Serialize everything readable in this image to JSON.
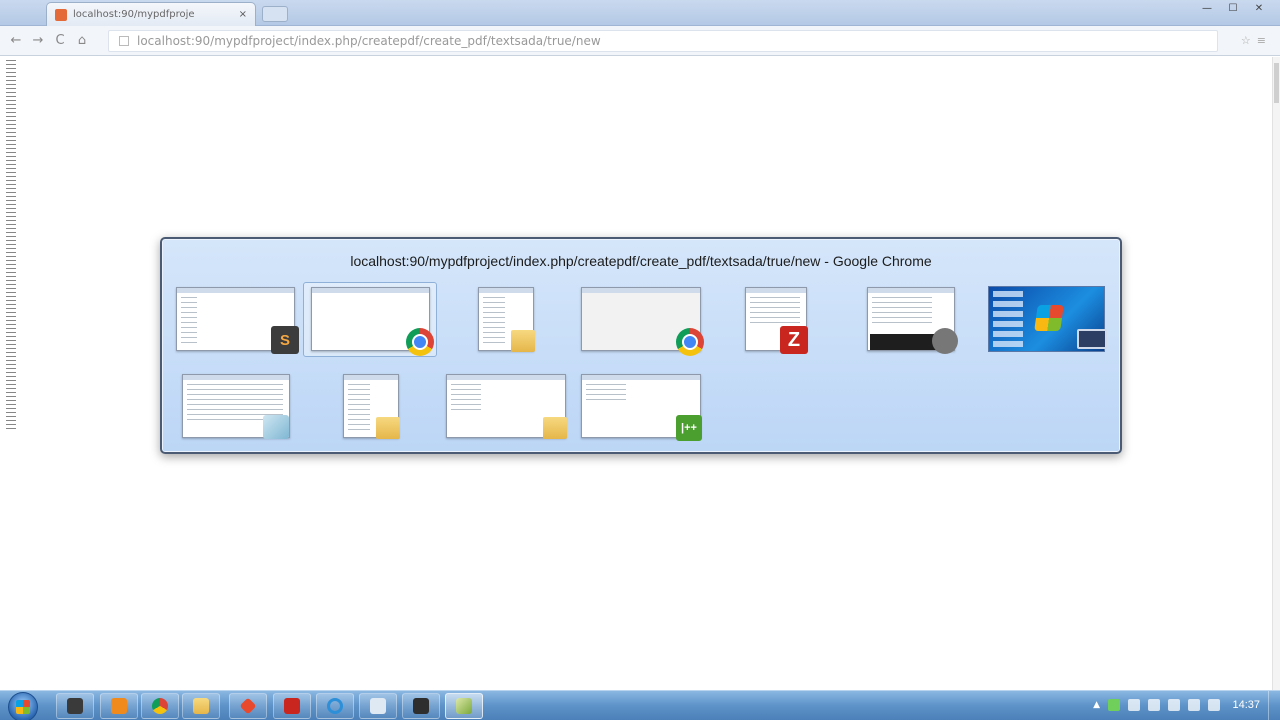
{
  "browser": {
    "tab_title": "localhost:90/mypdfproje",
    "tab_close": "×",
    "address": "localhost:90/mypdfproject/index.php/createpdf/create_pdf/textsada/true/new",
    "window_controls": {
      "minimize": "—",
      "maximize": "☐",
      "close": "✕"
    },
    "nav": {
      "back": "←",
      "forward": "→",
      "reload": "C",
      "home": "⌂"
    }
  },
  "switcher": {
    "title": "localhost:90/mypdfproject/index.php/createpdf/create_pdf/textsada/true/new - Google Chrome",
    "windows": [
      {
        "app": "sublime-text",
        "badge": "S"
      },
      {
        "app": "google-chrome",
        "selected": true
      },
      {
        "app": "windows-explorer"
      },
      {
        "app": "google-chrome"
      },
      {
        "app": "filezilla",
        "badge": "Z"
      },
      {
        "app": "command-tool"
      },
      {
        "app": "desktop"
      },
      {
        "app": "notepad"
      },
      {
        "app": "windows-explorer"
      },
      {
        "app": "windows-explorer"
      },
      {
        "app": "wordpad-document",
        "badge": "|++"
      }
    ]
  },
  "taskbar": {
    "items": [
      "windows-start",
      "media-center",
      "vlc",
      "google-chrome",
      "windows-explorer",
      "git",
      "filezilla",
      "internet-explorer",
      "notepad",
      "command-tool",
      "editor"
    ],
    "clock": "14:37"
  },
  "colors": {
    "switcher_bg": "#c9defa",
    "taskbar": "#5e93c9",
    "filezilla": "#c8261e"
  }
}
